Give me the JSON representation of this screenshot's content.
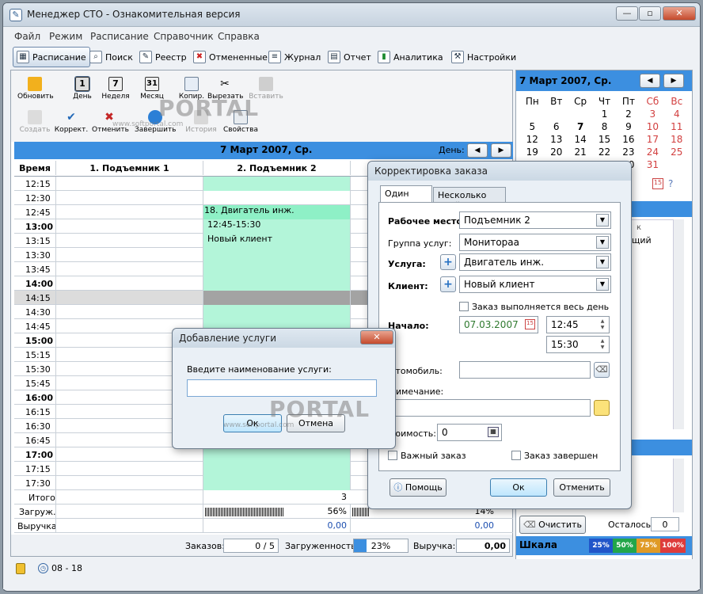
{
  "window": {
    "title": "Менеджер СТО - Ознакомительная версия"
  },
  "menu": [
    "Файл",
    "Режим",
    "Расписание",
    "Справочник",
    "Справка"
  ],
  "toolbar": [
    "Расписание",
    "Поиск",
    "Реестр",
    "Отмененные",
    "Журнал",
    "Отчет",
    "Аналитика",
    "Настройки"
  ],
  "schedule_toolbar": {
    "row1": [
      "Обновить",
      "День",
      "Неделя",
      "Месяц",
      "Копир.",
      "Вырезать",
      "Вставить"
    ],
    "row2": [
      "Создать",
      "Коррект.",
      "Отменить",
      "Завершить",
      "История",
      "Свойства"
    ]
  },
  "day": {
    "date": "7 Март 2007, Ср.",
    "label": "День:"
  },
  "grid": {
    "headers": [
      "Время",
      "1. Подъемник 1",
      "2. Подъемник 2"
    ],
    "times": [
      "12:15",
      "12:30",
      "12:45",
      "13:00",
      "13:15",
      "13:30",
      "13:45",
      "14:00",
      "14:15",
      "14:30",
      "14:45",
      "15:00",
      "15:15",
      "15:30",
      "15:45",
      "16:00",
      "16:15",
      "16:30",
      "16:45",
      "17:00",
      "17:15",
      "17:30"
    ],
    "event": {
      "title": "18. Двигатель инж.",
      "time": "12:45-15:30",
      "client": "Новый клиент"
    },
    "footer": {
      "total_label": "Итого",
      "total_value": "3",
      "load_label": "Загруж.",
      "load_value": "56%",
      "load_value2": "14%",
      "revenue_label": "Выручка",
      "revenue_value": "0,00",
      "revenue_value2": "0,00"
    }
  },
  "status": {
    "orders_label": "Заказов:",
    "orders_value": "0 / 5",
    "load_label": "Загруженность:",
    "load_value": "23%",
    "revenue_label": "Выручка:",
    "revenue_value": "0,00"
  },
  "calendar": {
    "title": "7 Март 2007, Ср.",
    "weekdays": [
      "Пн",
      "Вт",
      "Ср",
      "Чт",
      "Пт",
      "Сб",
      "Вс"
    ],
    "weeks": [
      [
        "",
        "",
        "",
        "1",
        "2",
        "3",
        "4"
      ],
      [
        "5",
        "6",
        "7",
        "8",
        "9",
        "10",
        "11"
      ],
      [
        "12",
        "13",
        "14",
        "15",
        "16",
        "17",
        "18"
      ],
      [
        "19",
        "20",
        "21",
        "22",
        "23",
        "24",
        "25"
      ],
      [
        "26",
        "27",
        "28",
        "29",
        "30",
        "31",
        ""
      ]
    ],
    "grid_frag": [
      "к",
      "щий"
    ]
  },
  "right_bottom": {
    "clear": "Очистить",
    "left_label": "Осталось:",
    "left_value": "0",
    "scale_label": "Шкала",
    "scale": [
      "25%",
      "50%",
      "75%",
      "100%"
    ],
    "scale_colors": [
      "#2155c9",
      "#22a64a",
      "#e09a26",
      "#de3b3b"
    ]
  },
  "correct_dialog": {
    "title": "Корректировка заказа",
    "tabs": [
      "Один день",
      "Несколько дней"
    ],
    "workplace_label": "Рабочее место:",
    "workplace": "Подъемник 2",
    "group_label": "Группа услуг:",
    "group": "Монитораа",
    "service_label": "Услуга:",
    "service": "Двигатель инж.",
    "client_label": "Клиент:",
    "client": "Новый клиент",
    "allday": "Заказ выполняется весь день",
    "start_label": "Начало:",
    "date": "07.03.2007",
    "time_start": "12:45",
    "time_end": "15:30",
    "car_label": "втомобиль:",
    "note_label": "римечание:",
    "cost_label": "тоимость:",
    "cost": "0",
    "important": "Важный заказ",
    "done": "Заказ завершен",
    "help": "Помощь",
    "ok": "Ок",
    "cancel": "Отменить"
  },
  "add_dialog": {
    "title": "Добавление услуги",
    "prompt": "Введите наименование услуги:",
    "ok": "Ок",
    "cancel": "Отмена"
  },
  "bottom_status": {
    "hours": "08 - 18"
  },
  "watermark": {
    "text": "PORTAL",
    "url": "www.softportal.com"
  }
}
